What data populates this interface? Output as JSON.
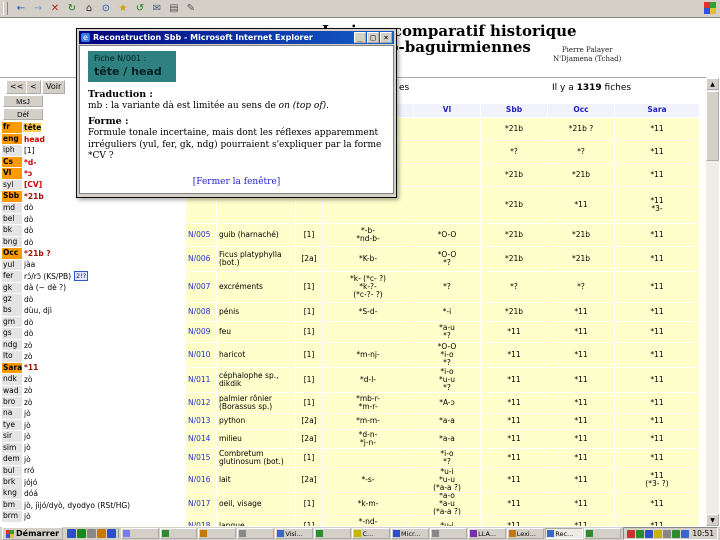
{
  "chrome": {
    "toolbar_icons": [
      {
        "name": "back-icon",
        "glyph": "←",
        "color": "#1b52c4"
      },
      {
        "name": "forward-icon",
        "glyph": "→",
        "color": "#7a9bd4"
      },
      {
        "name": "stop-icon",
        "glyph": "✕",
        "color": "#b22222"
      },
      {
        "name": "refresh-icon",
        "glyph": "↻",
        "color": "#1a7a1a"
      },
      {
        "name": "home-icon",
        "glyph": "⌂",
        "color": "#333333"
      },
      {
        "name": "search-icon",
        "glyph": "⊙",
        "color": "#1b52c4"
      },
      {
        "name": "favorites-icon",
        "glyph": "★",
        "color": "#c8a000"
      },
      {
        "name": "history-icon",
        "glyph": "↺",
        "color": "#1a7a1a"
      },
      {
        "name": "mail-icon",
        "glyph": "✉",
        "color": "#445577"
      },
      {
        "name": "print-icon",
        "glyph": "▤",
        "color": "#555555"
      },
      {
        "name": "edit-icon",
        "glyph": "✎",
        "color": "#555555"
      }
    ]
  },
  "page": {
    "title_line1": "Lexique comparatif historique",
    "title_line2": "des langues sara-bongo-baguirmiennes",
    "author": "Pierre Palayer",
    "location": "N'Djamena (Tchad)",
    "nav": {
      "first": "<<",
      "prev": "<",
      "voir": "Voir",
      "fragment": "es",
      "count_prefix": "Il y a",
      "count_number": "1319",
      "count_suffix": "fiches"
    },
    "sidebar": {
      "button_msj": "MsJ",
      "button_def": "Déf",
      "rows": [
        {
          "abbr": "fr",
          "val": "tête",
          "ac": "hl",
          "vc": "vb vbg"
        },
        {
          "abbr": "eng",
          "val": "head",
          "ac": "hl",
          "vc": "vred"
        },
        {
          "abbr": "iph",
          "val": "[1]",
          "ac": "",
          "vc": ""
        },
        {
          "abbr": "Cs",
          "val": "*d-",
          "ac": "hl",
          "vc": "vred"
        },
        {
          "abbr": "Vl",
          "val": "*ɔ",
          "ac": "hl",
          "vc": "vred"
        },
        {
          "abbr": "syl",
          "val": "[CV]",
          "ac": "",
          "vc": "vred"
        },
        {
          "abbr": "Sbb",
          "val": "*21b",
          "ac": "hl",
          "vc": "vmar"
        },
        {
          "abbr": "md",
          "val": "dò",
          "ac": "",
          "vc": ""
        },
        {
          "abbr": "bel",
          "val": "dò",
          "ac": "",
          "vc": ""
        },
        {
          "abbr": "bk",
          "val": "dò",
          "ac": "",
          "vc": ""
        },
        {
          "abbr": "bng",
          "val": "dò",
          "ac": "",
          "vc": ""
        },
        {
          "abbr": "Occ",
          "val": "*21b ?",
          "ac": "hl",
          "vc": "vmar"
        },
        {
          "abbr": "yul",
          "val": "jàa",
          "ac": "",
          "vc": ""
        },
        {
          "abbr": "fer",
          "val": "rɔ́/rɔ̃ (KS/PB)",
          "ac": "",
          "vc": "",
          "badge": "2!?"
        },
        {
          "abbr": "gk",
          "val": "dà (~ dè ?)",
          "ac": "",
          "vc": ""
        },
        {
          "abbr": "gz",
          "val": "dò",
          "ac": "",
          "vc": ""
        },
        {
          "abbr": "bs",
          "val": "dùu, djì",
          "ac": "",
          "vc": ""
        },
        {
          "abbr": "gm",
          "val": "dò",
          "ac": "",
          "vc": ""
        },
        {
          "abbr": "gs",
          "val": "dò",
          "ac": "",
          "vc": ""
        },
        {
          "abbr": "ndg",
          "val": "zò",
          "ac": "",
          "vc": ""
        },
        {
          "abbr": "lto",
          "val": "zò",
          "ac": "",
          "vc": ""
        },
        {
          "abbr": "Sara",
          "val": "*11",
          "ac": "hl",
          "vc": "vmar"
        },
        {
          "abbr": "ndk",
          "val": "zò",
          "ac": "",
          "vc": ""
        },
        {
          "abbr": "wad",
          "val": "zò",
          "ac": "",
          "vc": ""
        },
        {
          "abbr": "bro",
          "val": "zò",
          "ac": "",
          "vc": ""
        },
        {
          "abbr": "na",
          "val": "jò",
          "ac": "",
          "vc": ""
        },
        {
          "abbr": "tye",
          "val": "jò",
          "ac": "",
          "vc": ""
        },
        {
          "abbr": "sir",
          "val": "jò",
          "ac": "",
          "vc": ""
        },
        {
          "abbr": "sim",
          "val": "jò",
          "ac": "",
          "vc": ""
        },
        {
          "abbr": "dem",
          "val": "jò",
          "ac": "",
          "vc": ""
        },
        {
          "abbr": "bul",
          "val": "rró",
          "ac": "",
          "vc": ""
        },
        {
          "abbr": "brk",
          "val": "jójó",
          "ac": "",
          "vc": ""
        },
        {
          "abbr": "kng",
          "val": "dóá",
          "ac": "",
          "vc": ""
        },
        {
          "abbr": "bm",
          "val": "jò, jìjó/dyò, dyodyo (RSt/HG)",
          "ac": "",
          "vc": ""
        },
        {
          "abbr": "brm",
          "val": "jò",
          "ac": "",
          "vc": ""
        }
      ]
    },
    "table": {
      "headers": {
        "vl": "Vl",
        "sbb": "Sbb",
        "occ": "Occ",
        "sara": "Sara"
      },
      "rows": [
        {
          "no": "",
          "gloss": "",
          "cl": "",
          "cs": "",
          "vl": "",
          "sbb": "*21b",
          "occ": "*21b ?",
          "sara": "*11",
          "h": 22
        },
        {
          "no": "",
          "gloss": "",
          "cl": "",
          "cs": "",
          "vl": "",
          "sbb": "*?",
          "occ": "*?",
          "sara": "*11",
          "h": 22
        },
        {
          "no": "",
          "gloss": "",
          "cl": "",
          "cs": "",
          "vl": "",
          "sbb": "*21b",
          "occ": "*21b",
          "sara": "*11",
          "h": 22
        },
        {
          "no": "",
          "gloss": "",
          "cl": "",
          "cs": "",
          "vl": "",
          "sbb": "*21b",
          "occ": "*11",
          "sara": "*11\n*3-",
          "h": 36
        },
        {
          "no": "N/005",
          "gloss": "guib (harnaché)",
          "cl": "[1]",
          "cs": "*-b-\n*nd-b-",
          "vl": "*O-O",
          "sbb": "*21b",
          "occ": "*21b",
          "sara": "*11",
          "h": 22
        },
        {
          "no": "N/006",
          "gloss": "Ficus platyphylla (bot.)",
          "cl": "[2a]",
          "cs": "*K-b-",
          "vl": "*O-O\n*?",
          "sbb": "*21b",
          "occ": "*21b",
          "sara": "*11",
          "h": 24
        },
        {
          "no": "N/007",
          "gloss": "excréments",
          "cl": "[1]",
          "cs": "*k- (*c- ?)\n*k-?-\n(*c-?- ?)",
          "vl": "*?",
          "sbb": "*?",
          "occ": "*?",
          "sara": "*11",
          "h": 30
        },
        {
          "no": "N/008",
          "gloss": "pénis",
          "cl": "[1]",
          "cs": "*S-d-",
          "vl": "*-i",
          "sbb": "*21b",
          "occ": "*11",
          "sara": "*11",
          "h": 18
        },
        {
          "no": "N/009",
          "gloss": "feu",
          "cl": "[1]",
          "cs": "",
          "vl": "*a-u\n*?",
          "sbb": "*11",
          "occ": "*11",
          "sara": "*11",
          "h": 20
        },
        {
          "no": "N/010",
          "gloss": "haricot",
          "cl": "[1]",
          "cs": "*m-nj-",
          "vl": "*O-O\n*i-o\n*?",
          "sbb": "*11",
          "occ": "*11",
          "sara": "*11",
          "h": 24
        },
        {
          "no": "N/011",
          "gloss": "céphalophe sp., dikdik",
          "cl": "[1]",
          "cs": "*d-l-",
          "vl": "*i-o\n*u-u\n*?",
          "sbb": "*11",
          "occ": "*11",
          "sara": "*11",
          "h": 24
        },
        {
          "no": "N/012",
          "gloss": "palmier rônier (Borassus sp.)",
          "cl": "[1]",
          "cs": "*mb-r-\n*m-r-",
          "vl": "*A-ɔ",
          "sbb": "*11",
          "occ": "*11",
          "sara": "*11",
          "h": 20
        },
        {
          "no": "N/013",
          "gloss": "python",
          "cl": "[2a]",
          "cs": "*m-m-",
          "vl": "*a-a",
          "sbb": "*11",
          "occ": "*11",
          "sara": "*11",
          "h": 15
        },
        {
          "no": "N/014",
          "gloss": "milieu",
          "cl": "[2a]",
          "cs": "*d-n-\n*j-n-",
          "vl": "*a-a",
          "sbb": "*11",
          "occ": "*11",
          "sara": "*11",
          "h": 18
        },
        {
          "no": "N/015",
          "gloss": "Combretum glutinosum (bot.)",
          "cl": "[1]",
          "cs": "",
          "vl": "*i-o\n*?",
          "sbb": "*11",
          "occ": "*11",
          "sara": "*11",
          "h": 18
        },
        {
          "no": "N/016",
          "gloss": "lait",
          "cl": "[2a]",
          "cs": "*-s-",
          "vl": "*u-i\n*u-u\n(*a-a ?)",
          "sbb": "*11",
          "occ": "*11",
          "sara": "*11\n(*3- ?)",
          "h": 24
        },
        {
          "no": "N/017",
          "gloss": "oeil, visage",
          "cl": "[1]",
          "cs": "*k-m-",
          "vl": "*a-o\n*a-u\n(*a-a ?)",
          "sbb": "*11",
          "occ": "*11",
          "sara": "*11",
          "h": 22
        },
        {
          "no": "N/018",
          "gloss": "langue",
          "cl": "[1]",
          "cs": "*-nd-\n*-nd- ?",
          "vl": "*u-i",
          "sbb": "*11",
          "occ": "*11",
          "sara": "*11",
          "h": 20
        }
      ]
    },
    "scrollbar": {
      "up": "▲",
      "down": "▼"
    }
  },
  "popup": {
    "title": "Reconstruction Sbb - Microsoft Internet Explorer",
    "window_buttons": {
      "minimize": "_",
      "maximize": "□",
      "close": "×"
    },
    "fiche_label": "Fiche N/001 :",
    "headword": "tête / head",
    "traduction_label": "Traduction :",
    "trad_pre": "mb : la variante dà est limitée au sens de ",
    "trad_italic": "on (top of)",
    "trad_post": ".",
    "forme_label": "Forme :",
    "forme_text": "Formule tonale incertaine, mais dont les réflexes apparemment irréguliers (yul, fer, gk, ndg) pourraient s'expliquer par la forme *CV ?",
    "close_link": "[Fermer la fenêtre]"
  },
  "taskbar": {
    "start_label": "Démarrer",
    "clock": "10:51",
    "quicklaunch": [
      {
        "c": "#2d50c8"
      },
      {
        "c": "#1a8a1a"
      },
      {
        "c": "#888888"
      },
      {
        "c": "#c87800"
      },
      {
        "c": "#2d50c8"
      }
    ],
    "buttons": [
      {
        "label": "",
        "ic": "#7a7aff"
      },
      {
        "label": "",
        "ic": "#2d8a2d"
      },
      {
        "label": "",
        "ic": "#c87800"
      },
      {
        "label": "",
        "ic": "#888888"
      },
      {
        "label": "Visi...",
        "ic": "#3a66cc"
      },
      {
        "label": "",
        "ic": "#2d8a2d"
      },
      {
        "label": "C...",
        "ic": "#c8b400"
      },
      {
        "label": "Micr...",
        "ic": "#2d50c8"
      },
      {
        "label": "",
        "ic": "#888888"
      },
      {
        "label": "LLA...",
        "ic": "#7a30a0"
      },
      {
        "label": "Lexi...",
        "ic": "#c87800"
      },
      {
        "label": "Rec...",
        "ic": "#3a66cc",
        "active": true
      },
      {
        "label": "",
        "ic": "#2d8a2d"
      }
    ],
    "tray": [
      {
        "c": "#c83232"
      },
      {
        "c": "#2d8a2d"
      },
      {
        "c": "#2d50c8"
      },
      {
        "c": "#c8b400"
      },
      {
        "c": "#888888"
      },
      {
        "c": "#2d8a2d"
      },
      {
        "c": "#3a66cc"
      }
    ]
  }
}
